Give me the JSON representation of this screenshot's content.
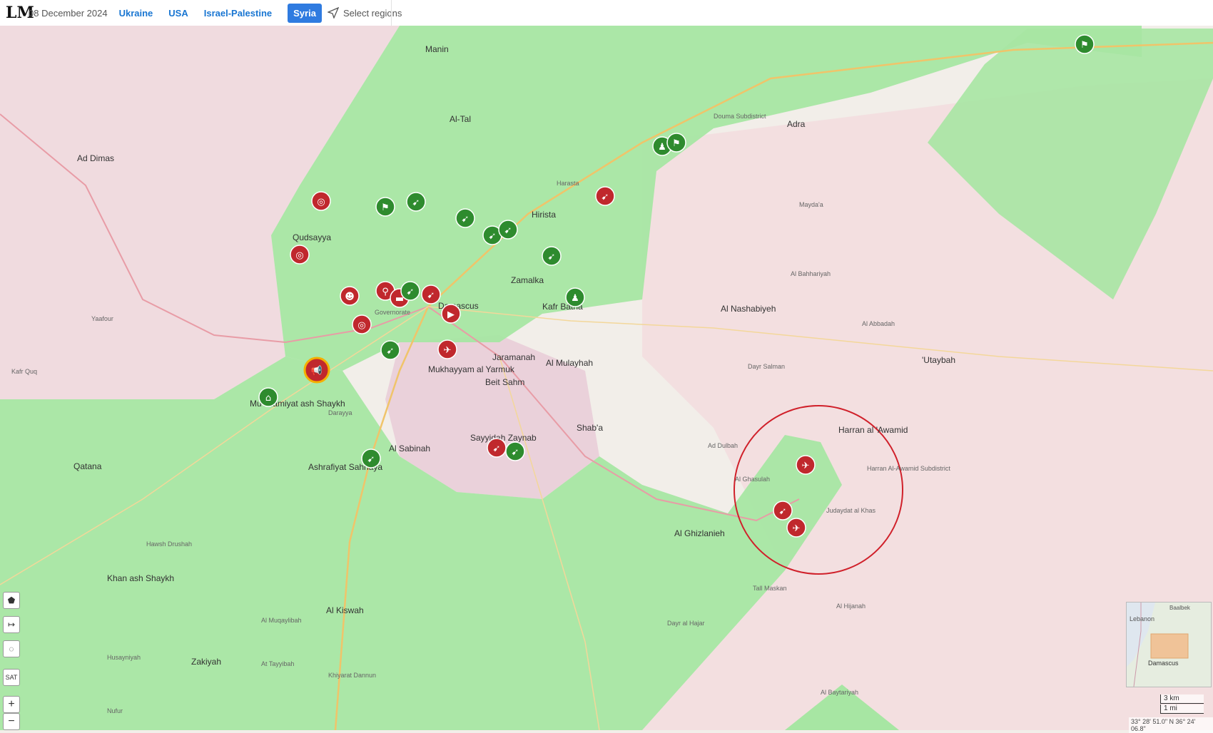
{
  "header": {
    "logo": "LM",
    "date": "08 December 2024",
    "regions": [
      "Ukraine",
      "USA",
      "Israel-Palestine"
    ],
    "active_region": "Syria",
    "select_label": "Select regions"
  },
  "map": {
    "colors": {
      "opposition": "#a7e6a3",
      "government": "#efd8de",
      "base": "#f2eee9",
      "road": "#f0c46a",
      "highway": "#e89ca6",
      "marker_green": "#2e8b2e",
      "marker_red": "#c0282d",
      "circle": "#d0202a"
    },
    "labels": {
      "damascus": "Damascus",
      "governorate": "Governorate",
      "qudsayya": "Qudsayya",
      "ad_dimas": "Ad Dimas",
      "al_tal": "Al-Tal",
      "harasta": "Harasta",
      "hirista": "Hirista",
      "douma": "Douma Subdistrict",
      "adra": "Adra",
      "zamalka": "Zamalka",
      "kafr_batna": "Kafr Batna",
      "jaramanah": "Jaramanah",
      "al_mulayhah": "Al Mulayhah",
      "mukhayyam": "Mukhayyam al Yarmuk",
      "beit_sahm": "Beit Sahm",
      "sayyidah": "Sayyidah Zaynab",
      "al_sabinah": "Al Sabinah",
      "qatana": "Qatana",
      "ashrafiyat": "Ashrafiyat Sahnaya",
      "muadamiyat": "Mu'adamiyat ash Shaykh",
      "darayya": "Darayya",
      "al_nashabiyeh": "Al Nashabiyeh",
      "harran": "Harran al 'Awamid",
      "utaybah": "'Utaybah",
      "al_ghizlanieh": "Al Ghizlanieh",
      "khan_ash_shaykh": "Khan ash Shaykh",
      "al_kiswah": "Al Kiswah",
      "zakiyah": "Zakiyah",
      "yaafour": "Yaafour",
      "al_ghasulah": "Al Ghasulah",
      "judaydat_al_khas": "Judaydat al Khas",
      "tall_maskan": "Tall Maskan",
      "shaba": "Shab'a",
      "manin": "Manin",
      "mayda": "Mayda'a",
      "al_bahhariyah": "Al Bahhariyah",
      "al_abbadah": "Al Abbadah",
      "dayr_salman": "Dayr Salman",
      "ad_dulbah": "Ad Dulbah",
      "al_hijanah": "Al Hijanah",
      "dayr_al_hajar": "Dayr al Hajar",
      "hawsh_drushah": "Hawsh Drushah",
      "al_muqaylibah": "Al Muqaylibah",
      "al_tayyibah": "At Tayyibah",
      "khiyarat_dannun": "Khiyarat Dannun",
      "nuhayr": "Nufur",
      "al_baytariyah": "Al Baytariyah",
      "kafr_quq": "Kafr Quq",
      "husayniyah": "Husayniyah",
      "harran_sub": "Harran Al-Awamid Subdistrict"
    },
    "markers": [
      {
        "color": "green",
        "icon": "rifle"
      },
      {
        "color": "green",
        "icon": "flag"
      },
      {
        "color": "red",
        "icon": "target"
      },
      {
        "color": "red",
        "icon": "target"
      },
      {
        "color": "green",
        "icon": "rifle"
      },
      {
        "color": "green",
        "icon": "rifle"
      },
      {
        "color": "green",
        "icon": "rifle"
      },
      {
        "color": "red",
        "icon": "rifle"
      },
      {
        "color": "green",
        "icon": "people"
      },
      {
        "color": "green",
        "icon": "flag"
      },
      {
        "color": "green",
        "icon": "rifle"
      },
      {
        "color": "green",
        "icon": "people"
      },
      {
        "color": "red",
        "icon": "person"
      },
      {
        "color": "red",
        "icon": "pin"
      },
      {
        "color": "red",
        "icon": "tank"
      },
      {
        "color": "green",
        "icon": "rifle"
      },
      {
        "color": "red",
        "icon": "rifle"
      },
      {
        "color": "red",
        "icon": "video"
      },
      {
        "color": "red",
        "icon": "target"
      },
      {
        "color": "green",
        "icon": "rifle"
      },
      {
        "color": "red",
        "icon": "jet"
      },
      {
        "color": "green",
        "icon": "building"
      },
      {
        "color": "red",
        "icon": "megaphone"
      },
      {
        "color": "red",
        "icon": "rifle"
      },
      {
        "color": "green",
        "icon": "rifle"
      },
      {
        "color": "green",
        "icon": "rifle"
      },
      {
        "color": "red",
        "icon": "plane"
      },
      {
        "color": "red",
        "icon": "rifle"
      },
      {
        "color": "red",
        "icon": "plane"
      },
      {
        "color": "green",
        "icon": "flag"
      }
    ]
  },
  "controls": {
    "layers_icon": "polygon-icon",
    "measure_icon": "arrow-icon",
    "hide_icon": "eye-off-icon",
    "sat_label": "SAT",
    "zoom_in": "+",
    "zoom_out": "−"
  },
  "minimap": {
    "labels": [
      "Lebanon",
      "Baalbek",
      "Damascus"
    ]
  },
  "scale": {
    "km": "3 km",
    "mi": "1 mi"
  },
  "coords": "33° 28' 51.0\" N 36° 24' 06.8\""
}
